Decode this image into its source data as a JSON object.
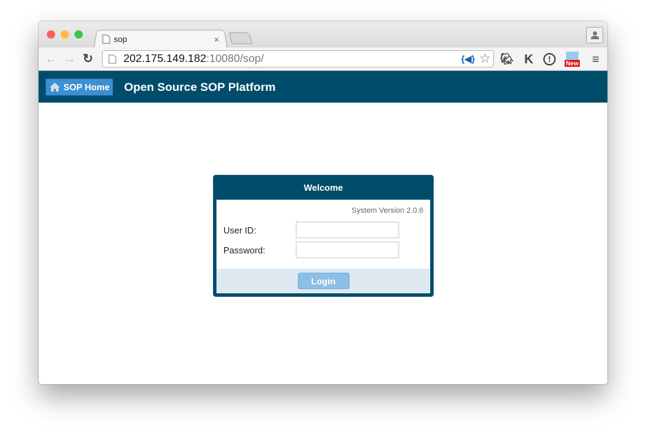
{
  "browser": {
    "tab_title": "sop",
    "url_host": "202.175.149.182",
    "url_rest": ":10080/sop/",
    "new_badge": "New"
  },
  "header": {
    "home_label": "SOP Home",
    "site_title": "Open Source SOP Platform"
  },
  "login": {
    "title": "Welcome",
    "version": "System Version 2.0.6",
    "user_label": "User ID:",
    "user_value": "",
    "password_label": "Password:",
    "password_value": "",
    "button": "Login"
  },
  "colors": {
    "header": "#004d6b",
    "home_button": "#3c8fd3",
    "login_button": "#8bbfe6"
  }
}
